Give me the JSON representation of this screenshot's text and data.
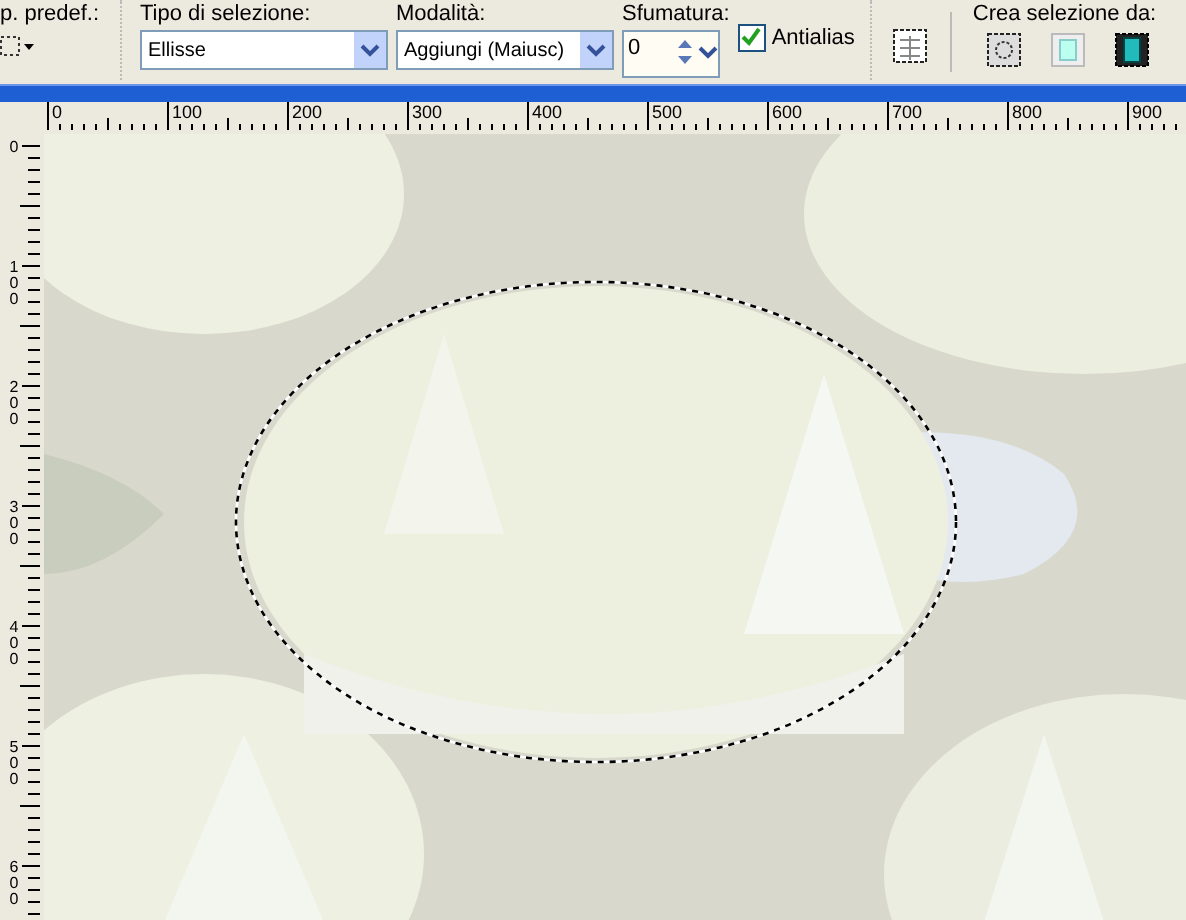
{
  "toolbar": {
    "preset": {
      "label": "p. predef.:"
    },
    "selection_type": {
      "label": "Tipo di selezione:",
      "value": "Ellisse"
    },
    "mode": {
      "label": "Modalità:",
      "value": "Aggiungi (Maiusc)"
    },
    "feather": {
      "label": "Sfumatura:",
      "value": "0"
    },
    "antialias": {
      "label": "Antialias",
      "checked": true
    },
    "create_from": {
      "label": "Crea selezione da:"
    }
  },
  "horizontal_ruler": [
    "0",
    "100",
    "200",
    "300",
    "400",
    "500",
    "600",
    "700",
    "800",
    "900"
  ],
  "vertical_ruler": [
    "0",
    "100",
    "200",
    "300",
    "400",
    "500",
    "600"
  ]
}
